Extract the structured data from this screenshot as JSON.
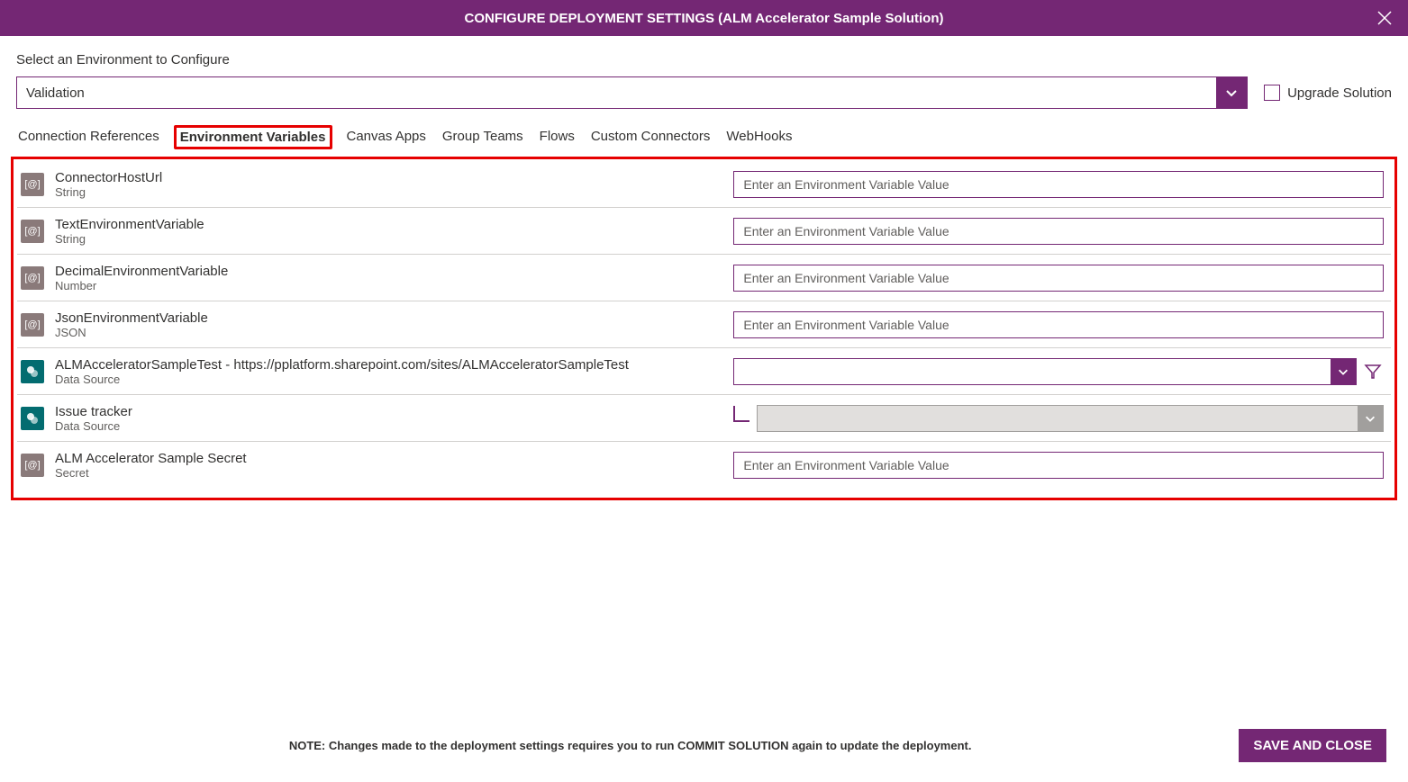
{
  "header": {
    "title": "CONFIGURE DEPLOYMENT SETTINGS (ALM Accelerator Sample Solution)"
  },
  "env": {
    "label": "Select an Environment to Configure",
    "value": "Validation",
    "upgrade_label": "Upgrade Solution"
  },
  "tabs": [
    {
      "label": "Connection References",
      "active": false
    },
    {
      "label": "Environment Variables",
      "active": true
    },
    {
      "label": "Canvas Apps",
      "active": false
    },
    {
      "label": "Group Teams",
      "active": false
    },
    {
      "label": "Flows",
      "active": false
    },
    {
      "label": "Custom Connectors",
      "active": false
    },
    {
      "label": "WebHooks",
      "active": false
    }
  ],
  "placeholder": "Enter an Environment Variable Value",
  "rows": [
    {
      "icon": "var",
      "title": "ConnectorHostUrl",
      "subtitle": "String",
      "input": "text"
    },
    {
      "icon": "var",
      "title": "TextEnvironmentVariable",
      "subtitle": "String",
      "input": "text"
    },
    {
      "icon": "var",
      "title": "DecimalEnvironmentVariable",
      "subtitle": "Number",
      "input": "text"
    },
    {
      "icon": "var",
      "title": "JsonEnvironmentVariable",
      "subtitle": "JSON",
      "input": "text"
    },
    {
      "icon": "sp",
      "title": "ALMAcceleratorSampleTest - https://pplatform.sharepoint.com/sites/ALMAcceleratorSampleTest",
      "subtitle": "Data Source",
      "input": "dropdown-filter"
    },
    {
      "icon": "sp",
      "title": "Issue tracker",
      "subtitle": "Data Source",
      "input": "dropdown-child"
    },
    {
      "icon": "var",
      "title": "ALM Accelerator Sample Secret",
      "subtitle": "Secret",
      "input": "text"
    }
  ],
  "footer": {
    "note": "NOTE: Changes made to the deployment settings requires you to run COMMIT SOLUTION again to update the deployment.",
    "save": "SAVE AND CLOSE"
  }
}
